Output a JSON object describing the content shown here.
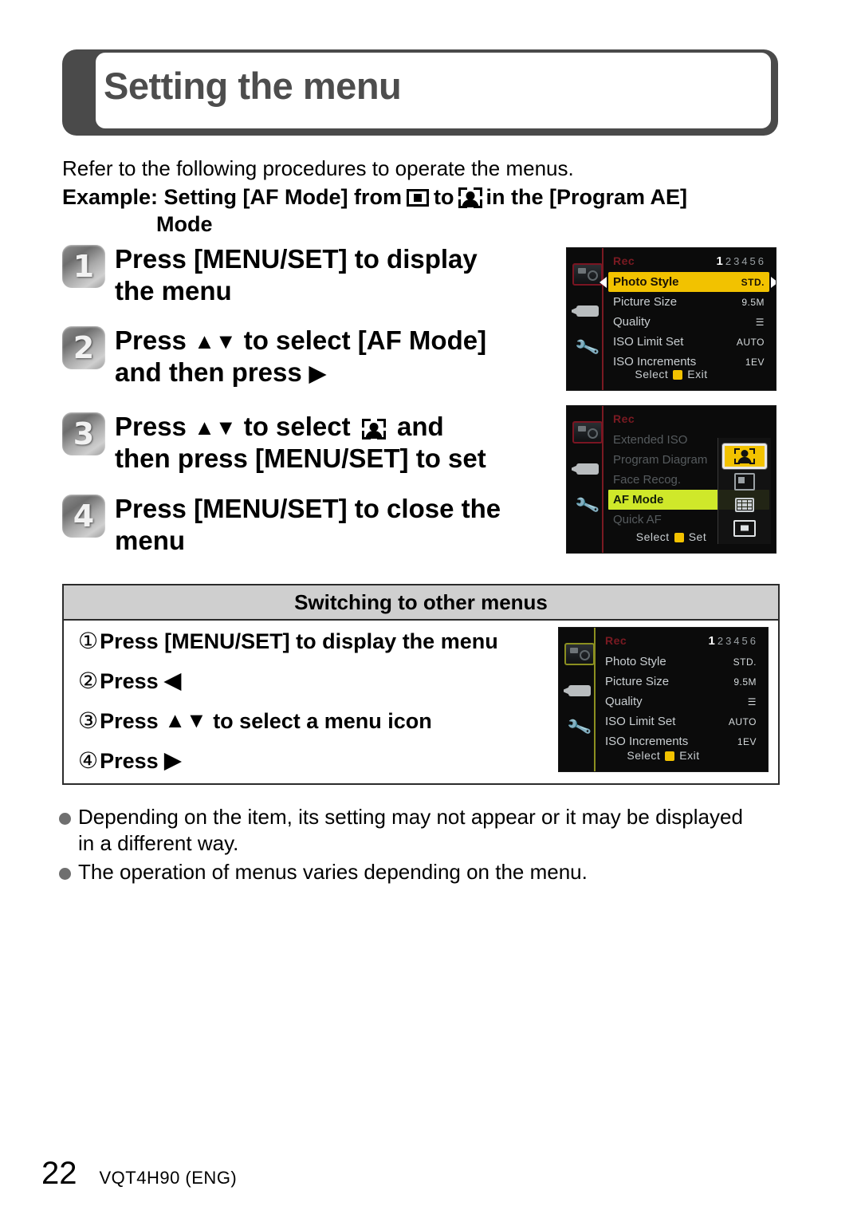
{
  "header": {
    "title": "Setting the menu"
  },
  "intro": {
    "line1": "Refer to the following procedures to operate the menus.",
    "example_prefix": "Example: Setting [AF Mode] from",
    "example_mid": "to",
    "example_suffix": "in the [Program AE]",
    "example_second_line": "Mode",
    "icon_from": "1-area-af-icon",
    "icon_to": "face-detection-icon"
  },
  "steps": [
    {
      "num": "1",
      "line1": "Press [MENU/SET] to display",
      "line2": "the menu"
    },
    {
      "num": "2",
      "line1_a": "Press",
      "line1_b": "to select [AF Mode]",
      "line2_a": "and then press",
      "arrows": "up-down"
    },
    {
      "num": "3",
      "line1_a": "Press",
      "line1_b": "to select",
      "line1_c": "and",
      "line2": "then press [MENU/SET] to set"
    },
    {
      "num": "4",
      "line1": "Press [MENU/SET] to close the",
      "line2": "menu"
    }
  ],
  "screens": {
    "rec_menu": {
      "title": "Rec",
      "pages_current": "1",
      "pages_rest": "23456",
      "rows": [
        {
          "label": "Photo Style",
          "value": "STD.",
          "state": "selected-yellow"
        },
        {
          "label": "Picture Size",
          "value": "9.5M",
          "state": "normal"
        },
        {
          "label": "Quality",
          "value": "☰",
          "state": "normal"
        },
        {
          "label": "ISO Limit Set",
          "value": "AUTO",
          "state": "normal"
        },
        {
          "label": "ISO Increments",
          "value": "1EV",
          "state": "normal"
        }
      ],
      "footer_left": "Select",
      "footer_right": "Exit"
    },
    "af_menu": {
      "title": "Rec",
      "rows": [
        {
          "label": "Extended ISO",
          "value": "",
          "state": "dim"
        },
        {
          "label": "Program Diagram",
          "value": "",
          "state": "dim"
        },
        {
          "label": "Face Recog.",
          "value": "",
          "state": "dim"
        },
        {
          "label": "AF Mode",
          "value": "",
          "state": "selected-green"
        },
        {
          "label": "Quick AF",
          "value": "",
          "state": "dim"
        }
      ],
      "options": [
        {
          "name": "face-detection-icon",
          "state": "selected"
        },
        {
          "name": "af-tracking-icon",
          "state": "normal"
        },
        {
          "name": "multi-area-af-icon",
          "state": "normal"
        },
        {
          "name": "1-area-af-icon",
          "state": "normal"
        }
      ],
      "footer_left": "Select",
      "footer_right": "Set"
    },
    "rec_menu_switch": {
      "title": "Rec",
      "pages_current": "1",
      "pages_rest": "23456",
      "rows": [
        {
          "label": "Photo Style",
          "value": "STD.",
          "state": "normal"
        },
        {
          "label": "Picture Size",
          "value": "9.5M",
          "state": "normal"
        },
        {
          "label": "Quality",
          "value": "☰",
          "state": "normal"
        },
        {
          "label": "ISO Limit Set",
          "value": "AUTO",
          "state": "normal"
        },
        {
          "label": "ISO Increments",
          "value": "1EV",
          "state": "normal"
        }
      ],
      "footer_left": "Select",
      "footer_right": "Exit"
    }
  },
  "switching_box": {
    "heading": "Switching to other menus",
    "items": [
      {
        "num": "①",
        "text_a": "Press [MENU/SET] to display the menu",
        "arrow": ""
      },
      {
        "num": "②",
        "text_a": "Press",
        "arrow": "left"
      },
      {
        "num": "③",
        "text_a": "Press",
        "text_b": "to select a menu icon",
        "arrow": "up-down"
      },
      {
        "num": "④",
        "text_a": "Press",
        "arrow": "right"
      }
    ]
  },
  "notes": [
    "Depending on the item, its setting may not appear or it may be displayed in a different way.",
    "The operation of menus varies depending on the menu."
  ],
  "footer": {
    "page_number": "22",
    "doc_code": "VQT4H90 (ENG)"
  },
  "colors": {
    "header_gray": "#4d4d4d",
    "menu_highlight_yellow": "#f2c200",
    "menu_highlight_green": "#cfe82a",
    "box_header_gray": "#cfcfcf",
    "bullet_gray": "#6f6f6f"
  }
}
